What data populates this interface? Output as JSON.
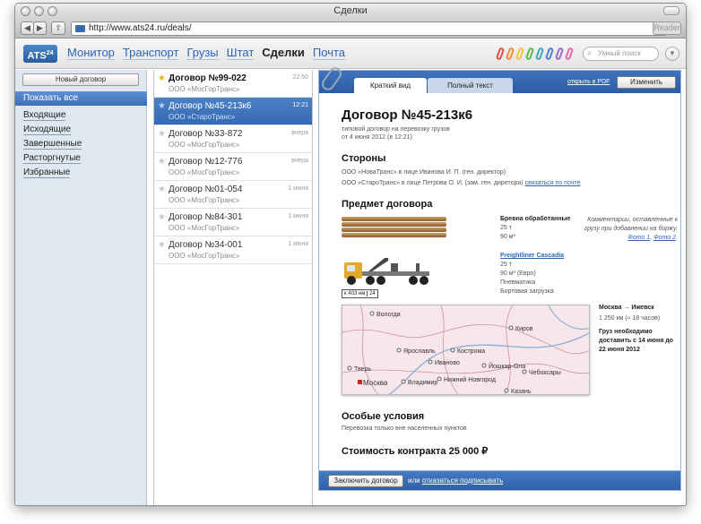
{
  "window": {
    "title": "Сделки"
  },
  "browser": {
    "url": "http://www.ats24.ru/deals/",
    "reader_label": "Reader"
  },
  "app": {
    "logo": "ATS",
    "logo_sup": "24",
    "nav": [
      "Монитор",
      "Транспорт",
      "Грузы",
      "Штат",
      "Сделки",
      "Почта"
    ],
    "nav_active": "Сделки",
    "search_placeholder": "Умный поиск",
    "clip_colors": [
      "#e24b4b",
      "#f08a3c",
      "#f3c13c",
      "#5bbb4a",
      "#3ea6b8",
      "#4f7fd1",
      "#9b6bd1",
      "#e86aa6"
    ]
  },
  "sidebar": {
    "new_button": "Новый договор",
    "all": "Показать все",
    "items": [
      "Входящие",
      "Исходящие",
      "Завершенные",
      "Расторгнутые",
      "Избранные"
    ]
  },
  "deals": [
    {
      "title": "Договор №99-022",
      "company": "ООО «МосГорТранс»",
      "time": "22:50",
      "starred": true,
      "bold": true
    },
    {
      "title": "Договор №45-213к6",
      "company": "ООО «СтароТранс»",
      "time": "12:21",
      "starred": false,
      "bold": false,
      "selected": true
    },
    {
      "title": "Договор №33-872",
      "company": "ООО «МосГорТранс»",
      "time": "вчера",
      "starred": false,
      "bold": false
    },
    {
      "title": "Договор №12-776",
      "company": "ООО «МосГорТранс»",
      "time": "вчера",
      "starred": false,
      "bold": false
    },
    {
      "title": "Договор №01-054",
      "company": "ООО «МосГорТранс»",
      "time": "1 июня",
      "starred": false,
      "bold": false
    },
    {
      "title": "Договор №84-301",
      "company": "ООО «МосГорТранс»",
      "time": "1 июня",
      "starred": false,
      "bold": false
    },
    {
      "title": "Договор №34-001",
      "company": "ООО «МосГорТранс»",
      "time": "1 июня",
      "starred": false,
      "bold": false
    }
  ],
  "detail": {
    "tab_brief": "Краткий вид",
    "tab_full": "Полный текст",
    "pdf_link": "открыть в PDF",
    "edit_button": "Изменить",
    "title": "Договор №45-213к6",
    "subtitle1": "типовой договор на перевозку грузов",
    "subtitle2": "от 4 июня 2012 (в 12:21)",
    "parties_h": "Стороны",
    "party1": "ООО «НоваТранс» в лице Иванова И. П. (ген. директор)",
    "party2": "ООО «СтароТранс» в лице Петрова О. И. (зам. ген. диретора)",
    "party2_link": "связаться по почте",
    "subject_h": "Предмет договора",
    "cargo_name": "Бревна обработанные",
    "cargo_weight": "25 т",
    "cargo_volume": "90 м³",
    "comment": "Комментарии, оставленные к грузу при добавлении на биржу.",
    "photo1": "Фото 1",
    "photo2": "Фото 2",
    "truck_name": "Freightliner Cascadia",
    "truck_weight": "25 т",
    "truck_volume": "90 м³ (Евро)",
    "truck_type": "Пневматика",
    "truck_loading": "Бортовая загрузка",
    "plate_left": "к 403 нм",
    "plate_right": "24",
    "route": "Москва → Ижевск",
    "route_meta": "1 250 км (≈ 18 часов)",
    "deliver_text": "Груз необходимо доставить с 14 июня до 22 июня 2012",
    "map_cities": [
      "Вологда",
      "Киров",
      "Ярославль",
      "Кострома",
      "Иваново",
      "Тверь",
      "Владимир",
      "Йошкар-Ола",
      "Нижний Новгород",
      "Чебоксары",
      "Казань",
      "Москва"
    ],
    "special_h": "Особые условия",
    "special_text": "Перевозка только вне населенных пунктов",
    "cost_h": "Стоимость контракта 25 000 ₽",
    "contract_button": "Заключить договор",
    "or_text": "или",
    "refuse_link": "отказаться подписывать"
  }
}
